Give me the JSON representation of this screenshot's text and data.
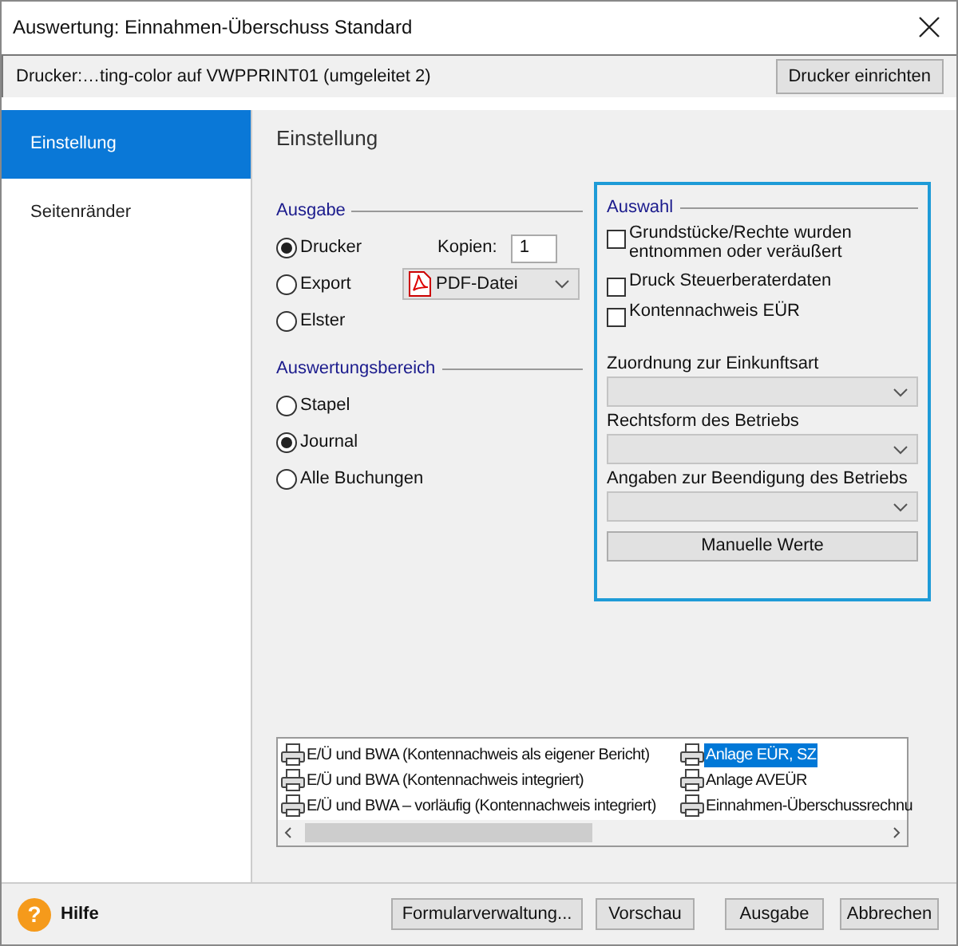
{
  "window": {
    "title": "Auswertung: Einnahmen-Überschuss Standard"
  },
  "printer_bar": {
    "text": "Drucker:…ting-color auf VWPPRINT01 (umgeleitet 2)",
    "button": "Drucker einrichten"
  },
  "sidebar": {
    "items": [
      {
        "label": "Einstellung",
        "selected": true
      },
      {
        "label": "Seitenränder",
        "selected": false
      }
    ]
  },
  "panel": {
    "title": "Einstellung"
  },
  "ausgabe": {
    "title": "Ausgabe",
    "options": [
      {
        "label": "Drucker",
        "selected": true
      },
      {
        "label": "Export",
        "selected": false
      },
      {
        "label": "Elster",
        "selected": false
      }
    ],
    "copies_label": "Kopien:",
    "copies_value": "1",
    "export_format": "PDF-Datei"
  },
  "bereich": {
    "title": "Auswertungsbereich",
    "options": [
      {
        "label": "Stapel",
        "selected": false
      },
      {
        "label": "Journal",
        "selected": true
      },
      {
        "label": "Alle Buchungen",
        "selected": false
      }
    ]
  },
  "auswahl": {
    "title": "Auswahl",
    "checkboxes": [
      {
        "label": "Grundstücke/Rechte wurden entnommen oder veräußert",
        "checked": false
      },
      {
        "label": "Druck Steuerberaterdaten",
        "checked": false
      },
      {
        "label": "Kontennachweis EÜR",
        "checked": false
      }
    ],
    "dropdowns": [
      {
        "label": "Zuordnung zur Einkunftsart",
        "disabled": true
      },
      {
        "label": "Rechtsform des Betriebs",
        "disabled": true
      },
      {
        "label": "Angaben zur Beendigung des Betriebs",
        "disabled": true
      }
    ],
    "button": "Manuelle Werte"
  },
  "report_list": {
    "columns": [
      [
        {
          "label": "E/Ü und BWA (Kontennachweis als eigener Bericht)",
          "selected": false
        },
        {
          "label": "E/Ü und BWA (Kontennachweis integriert)",
          "selected": false
        },
        {
          "label": "E/Ü und BWA – vorläufig (Kontennachweis integriert)",
          "selected": false
        }
      ],
      [
        {
          "label": "Anlage EÜR, SZ",
          "selected": true
        },
        {
          "label": "Anlage AVEÜR",
          "selected": false
        },
        {
          "label": "Einnahmen-Überschussrechnu",
          "selected": false
        }
      ]
    ]
  },
  "footer": {
    "help": "Hilfe",
    "help_icon": "?",
    "buttons": [
      "Formularverwaltung...",
      "Vorschau",
      "Ausgabe",
      "Abbrechen"
    ]
  }
}
